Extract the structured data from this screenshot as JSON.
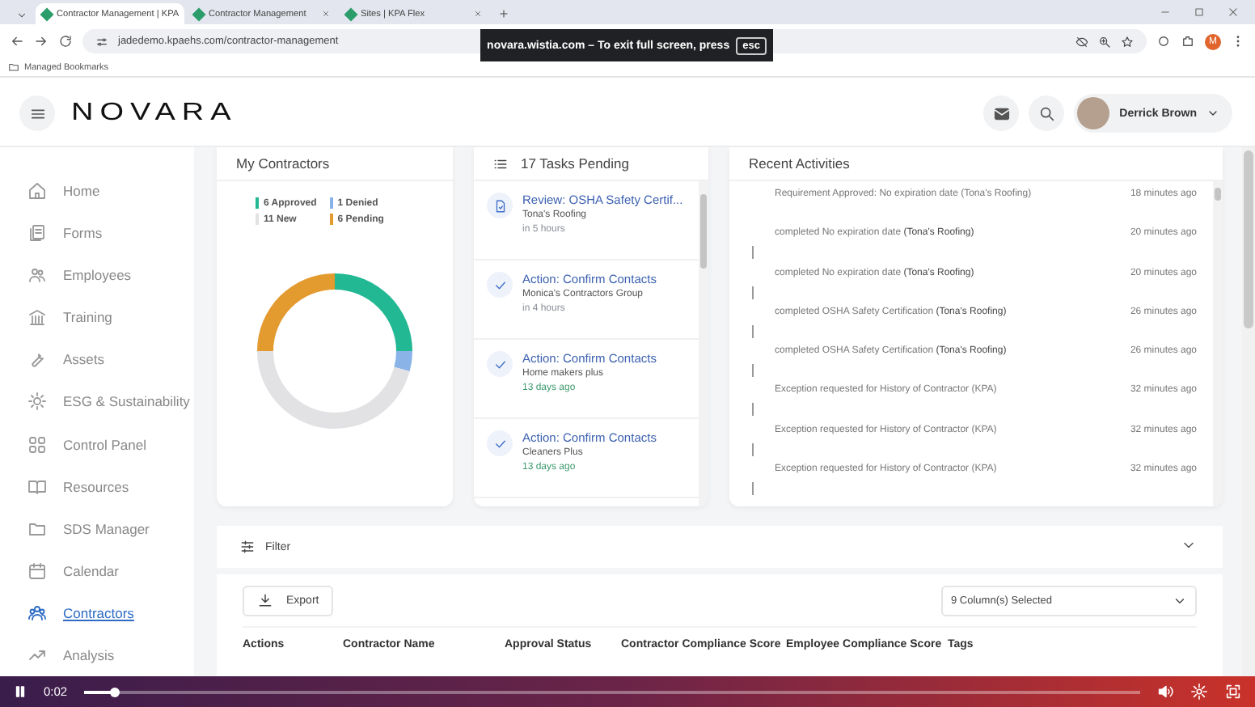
{
  "browser": {
    "tabs": [
      {
        "label": "Contractor Management | KPA",
        "selected": true
      },
      {
        "label": "Contractor Management",
        "selected": false
      },
      {
        "label": "Sites | KPA Flex",
        "selected": false
      }
    ],
    "url": "jadedemo.kpaehs.com/contractor-management",
    "bookmarks": [
      {
        "label": "Managed Bookmarks"
      }
    ],
    "profile": "M"
  },
  "fullscreen_notice": {
    "text": "novara.wistia.com – To exit full screen, press",
    "key": "esc"
  },
  "header": {
    "logo": "NOVARA",
    "user": "Derrick Brown"
  },
  "sidebar": {
    "items": [
      {
        "label": "Home",
        "selected": false
      },
      {
        "label": "Forms",
        "selected": false
      },
      {
        "label": "Employees",
        "selected": false
      },
      {
        "label": "Training",
        "selected": false
      },
      {
        "label": "Assets",
        "selected": false
      },
      {
        "label": "ESG & Sustainability",
        "selected": false
      },
      {
        "label": "Control Panel",
        "selected": false
      },
      {
        "label": "Resources",
        "selected": false
      },
      {
        "label": "SDS Manager",
        "selected": false
      },
      {
        "label": "Calendar",
        "selected": false
      },
      {
        "label": "Contractors",
        "selected": true
      },
      {
        "label": "Analysis",
        "selected": false
      }
    ]
  },
  "my_contractors": {
    "title": "My Contractors",
    "legend": [
      {
        "label": "6 Approved",
        "color": "#22b894"
      },
      {
        "label": "1 Denied",
        "color": "#8ab4e8"
      },
      {
        "label": "11 New",
        "color": "#e2e2e4"
      },
      {
        "label": "6 Pending",
        "color": "#e39a2f"
      }
    ],
    "chart_data": {
      "type": "donut",
      "values": [
        25,
        4.2,
        45.8,
        25
      ]
    }
  },
  "tasks": {
    "title": "17 Tasks Pending",
    "items": [
      {
        "kind": "review",
        "title": "Review: OSHA Safety Certif...",
        "company": "Tona's Roofing",
        "time": "in 5 hours",
        "color": "#8a8f98"
      },
      {
        "kind": "action",
        "title": "Action: Confirm Contacts",
        "company": "Monica's Contractors Group",
        "time": "in 4 hours",
        "color": "#8a8f98"
      },
      {
        "kind": "action",
        "title": "Action: Confirm Contacts",
        "company": "Home makers plus",
        "time": "13 days ago",
        "color": "#3f9b6e"
      },
      {
        "kind": "action",
        "title": "Action: Confirm Contacts",
        "company": "Cleaners Plus",
        "time": "13 days ago",
        "color": "#3f9b6e"
      }
    ]
  },
  "recent_activities": {
    "title": "Recent Activities",
    "items": [
      {
        "text": "Requirement Approved: No expiration date (Tona's Roofing)",
        "time": "18 minutes ago"
      },
      {
        "text": "completed No expiration date **(Tona's Roofing)**",
        "time": "20 minutes ago"
      },
      {
        "text": "completed No expiration date **(Tona's Roofing)**",
        "time": "20 minutes ago"
      },
      {
        "text": "completed OSHA Safety Certification **(Tona's Roofing)**",
        "time": "26 minutes ago"
      },
      {
        "text": "completed OSHA Safety Certification **(Tona's Roofing)**",
        "time": "26 minutes ago"
      },
      {
        "text": "Exception requested for History of Contractor (KPA)",
        "time": "32 minutes ago"
      },
      {
        "text": "Exception requested for History of Contractor (KPA)",
        "time": "32 minutes ago"
      },
      {
        "text": "Exception requested for History of Contractor (KPA)",
        "time": "32 minutes ago"
      }
    ]
  },
  "filter": {
    "label": "Filter"
  },
  "table": {
    "export": "Export",
    "columns_select": "9 Column(s) Selected",
    "columns": [
      "Actions",
      "Contractor Name",
      "Approval Status",
      "Contractor Compliance Score",
      "Employee Compliance Score",
      "Tags"
    ]
  },
  "video": {
    "time": "0:02",
    "level": 0.03
  }
}
